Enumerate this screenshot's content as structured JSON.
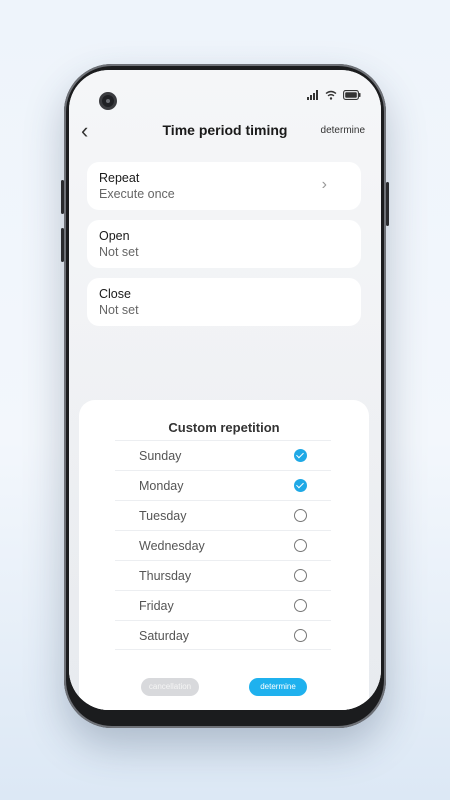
{
  "header": {
    "back_icon": "chevron-left-icon",
    "title": "Time period timing",
    "action_label": "determine"
  },
  "status_bar": {
    "icons": [
      "signal-icon",
      "wifi-icon",
      "battery-icon"
    ]
  },
  "settings": {
    "items": [
      {
        "title": "Repeat",
        "value": "Execute once",
        "icon": "chevron-right-icon"
      },
      {
        "title": "Open",
        "value": "Not set"
      },
      {
        "title": "Close",
        "value": "Not set"
      }
    ]
  },
  "sheet": {
    "title": "Custom repetition",
    "days": [
      {
        "label": "Sunday",
        "checked": true
      },
      {
        "label": "Monday",
        "checked": true
      },
      {
        "label": "Tuesday",
        "checked": false
      },
      {
        "label": "Wednesday",
        "checked": false
      },
      {
        "label": "Thursday",
        "checked": false
      },
      {
        "label": "Friday",
        "checked": false
      },
      {
        "label": "Saturday",
        "checked": false
      }
    ],
    "cancel_label": "cancellation",
    "confirm_label": "determine"
  },
  "colors": {
    "accent": "#1fb1ee",
    "check_on": "#1fa9e6",
    "cancel_bg": "#d8d9dc"
  }
}
